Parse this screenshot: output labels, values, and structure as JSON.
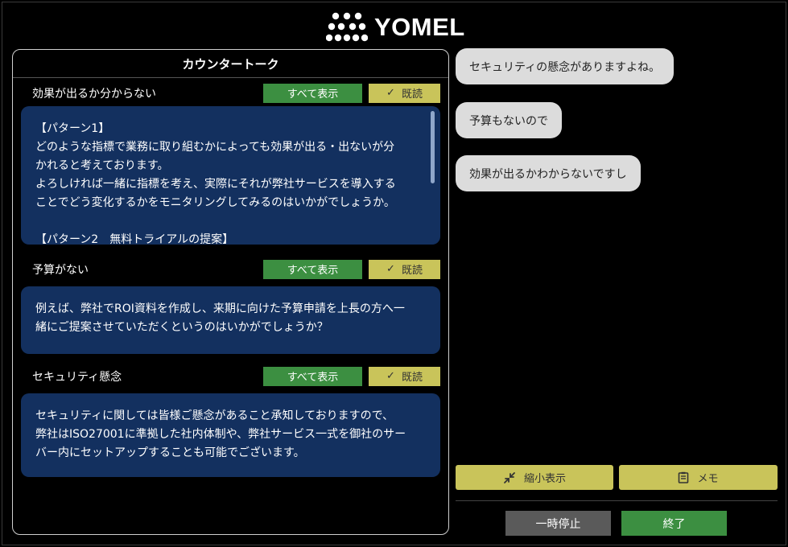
{
  "brand": {
    "logo_text": "YOMEL"
  },
  "counter_talk": {
    "title": "カウンタートーク",
    "sections": [
      {
        "title": "効果が出るか分からない",
        "show_all_label": "すべて表示",
        "read_label": "既読",
        "body": "【パターン1】\nどのような指標で業務に取り組むかによっても効果が出る・出ないが分\nかれると考えております。\nよろしければ一緒に指標を考え、実際にそれが弊社サービスを導入する\nことでどう変化するかをモニタリングしてみるのはいかがでしょうか。\n\n【パターン2　無料トライアルの提案】"
      },
      {
        "title": "予算がない",
        "show_all_label": "すべて表示",
        "read_label": "既読",
        "body": "例えば、弊社でROI資料を作成し、来期に向けた予算申請を上長の方へ一\n緒にご提案させていただくというのはいかがでしょうか？"
      },
      {
        "title": "セキュリティ懸念",
        "show_all_label": "すべて表示",
        "read_label": "既読",
        "body": "セキュリティに関しては皆様ご懸念があること承知しておりますので、\n弊社はISO27001に準拠した社内体制や、弊社サービス一式を御社のサー\nバー内にセットアップすることも可能でございます。"
      }
    ]
  },
  "transcript": {
    "messages": [
      {
        "text": "セキュリティの懸念がありますよね。"
      },
      {
        "text": "予算もないので"
      },
      {
        "text": "効果が出るかわからないですし"
      }
    ]
  },
  "actions": {
    "minimize_label": "縮小表示",
    "memo_label": "メモ",
    "pause_label": "一時停止",
    "end_label": "終了"
  },
  "colors": {
    "card_bg": "#13305f",
    "green": "#3c8f41",
    "khaki": "#c9c45a",
    "bubble": "#dcdcdc"
  }
}
